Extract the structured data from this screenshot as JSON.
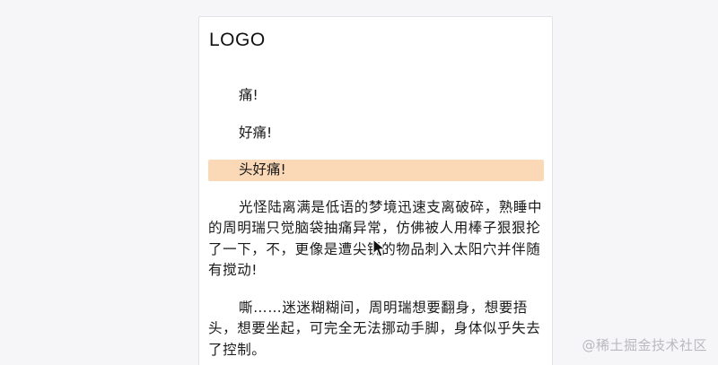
{
  "card": {
    "logo": "LOGO",
    "paragraphs": [
      {
        "text": "痛!",
        "highlighted": false
      },
      {
        "text": "好痛!",
        "highlighted": false
      },
      {
        "text": "头好痛!",
        "highlighted": true
      },
      {
        "text": "光怪陆离满是低语的梦境迅速支离破碎，熟睡中的周明瑞只觉脑袋抽痛异常，仿佛被人用棒子狠狠抡了一下，不，更像是遭尖锐的物品刺入太阳穴并伴随有搅动!",
        "highlighted": false
      },
      {
        "text": "嘶……迷迷糊糊间，周明瑞想要翻身，想要捂头，想要坐起，可完全无法挪动手脚，身体似乎失去了控制。",
        "highlighted": false
      }
    ]
  },
  "colors": {
    "highlight": "#fbd9b7",
    "page_background": "#f6f6f8",
    "card_background": "#ffffff"
  },
  "watermark": "@稀土掘金技术社区"
}
